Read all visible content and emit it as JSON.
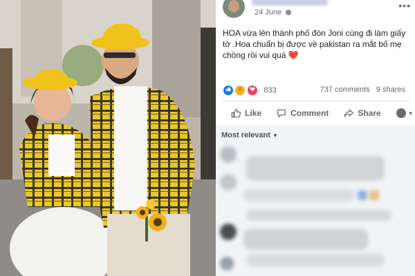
{
  "post": {
    "date": "24 June",
    "text": "HOA vừa lên thành phố đón Joni cùng đi làm giấy tờ .Hoa chuẩn bị được về pakistan ra mắt bố mẹ chồng rồi vui quá",
    "heart_emoji": "❤️",
    "reaction_count": "833",
    "comments_count": "737 comments",
    "shares_count": "9 shares",
    "more_glyph": "•••"
  },
  "actions": {
    "like_label": "Like",
    "comment_label": "Comment",
    "share_label": "Share"
  },
  "comments": {
    "sort_label": "Most relevant",
    "sort_caret": "▼"
  },
  "icons": {
    "globe": "globe-icon",
    "like": "thumbs-up-icon",
    "comment": "speech-bubble-icon",
    "share": "share-arrow-icon"
  },
  "colors": {
    "facebook_blue": "#1877f2",
    "love_red": "#f33e58",
    "haha_yellow": "#f7b125",
    "action_gray": "#606770",
    "comment_bg": "#f2f3f5"
  }
}
